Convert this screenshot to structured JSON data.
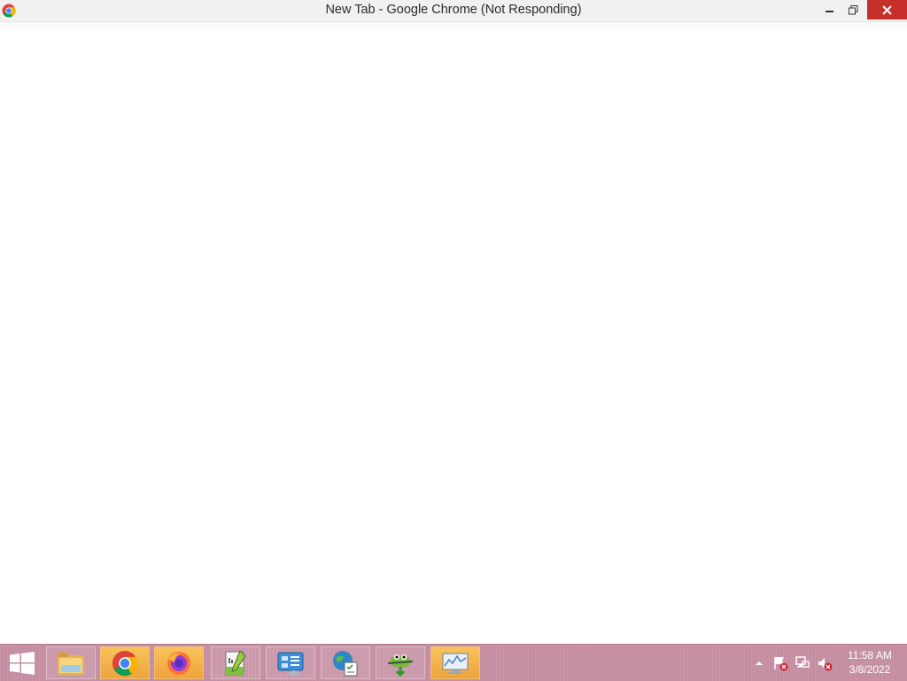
{
  "window": {
    "title": "New Tab - Google Chrome (Not Responding)",
    "controls": {
      "minimize_icon": "minimize-icon",
      "maximize_icon": "restore-icon",
      "close_icon": "close-icon"
    }
  },
  "taskbar": {
    "start_icon": "windows-logo-icon",
    "pinned": [
      {
        "name": "File Explorer",
        "icon": "folder-icon"
      },
      {
        "name": "Google Chrome",
        "icon": "chrome-icon"
      },
      {
        "name": "Firefox",
        "icon": "firefox-icon"
      },
      {
        "name": "Notepad++",
        "icon": "notepadpp-icon"
      },
      {
        "name": "Control Panel",
        "icon": "control-panel-icon"
      },
      {
        "name": "Internet Options",
        "icon": "internet-options-icon"
      },
      {
        "name": "Gecko Downloader",
        "icon": "gecko-icon"
      },
      {
        "name": "Performance Monitor",
        "icon": "monitor-icon"
      }
    ],
    "tray": {
      "show_hidden_icon": "chevron-up-icon",
      "flag_icon": "action-center-flag-icon",
      "network_icon": "network-icon",
      "volume_icon": "volume-muted-icon",
      "time": "11:58 AM",
      "date": "3/8/2022"
    }
  },
  "colors": {
    "taskbar": "#c58ea2",
    "close_button": "#c7302a",
    "active_taskbar_item": "#f0a53f"
  }
}
